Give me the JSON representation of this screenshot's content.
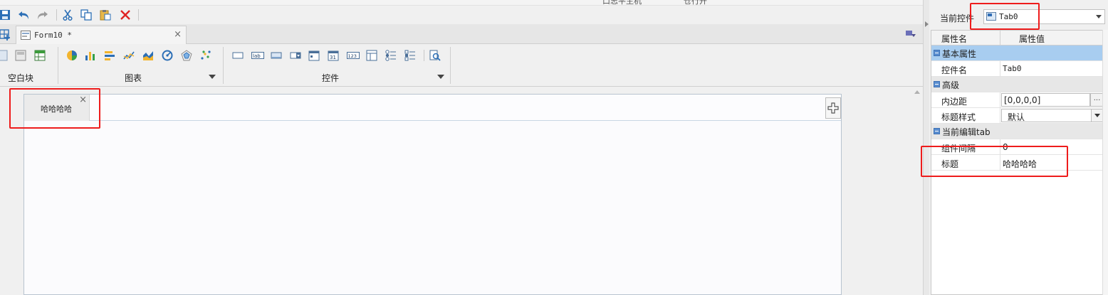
{
  "top_strip": {
    "left_text": "口志平主机",
    "right_text": "仓行开"
  },
  "quick_toolbar": {
    "icons": [
      "save-icon",
      "undo-icon",
      "redo-icon",
      "cut-icon",
      "copy-icon",
      "paste-icon",
      "delete-icon"
    ]
  },
  "doc_tab": {
    "title": "Form10 *",
    "close": "×"
  },
  "ribbon": {
    "groups": [
      {
        "label": "空白块"
      },
      {
        "label": "图表"
      },
      {
        "label": "控件"
      }
    ]
  },
  "canvas": {
    "tab_widget": {
      "tab_label": "哈哈哈哈",
      "tab_close": "×"
    }
  },
  "prop_panel": {
    "current_control_label": "当前控件",
    "current_control_value": "Tab0",
    "header": {
      "name_col": "属性名",
      "value_col": "属性值"
    },
    "sections": [
      {
        "title": "基本属性",
        "rows": [
          {
            "name": "控件名",
            "value": "Tab0"
          }
        ]
      },
      {
        "title": "高级",
        "rows": [
          {
            "name": "内边距",
            "value": "[0,0,0,0]",
            "button": "..."
          },
          {
            "name": "标题样式",
            "value": "默认"
          }
        ]
      },
      {
        "title": "当前编辑tab",
        "rows": [
          {
            "name": "组件间隔",
            "value": "0"
          },
          {
            "name": "标题",
            "value": "哈哈哈哈"
          }
        ]
      }
    ]
  },
  "highlight_color": "#ee1c1c"
}
